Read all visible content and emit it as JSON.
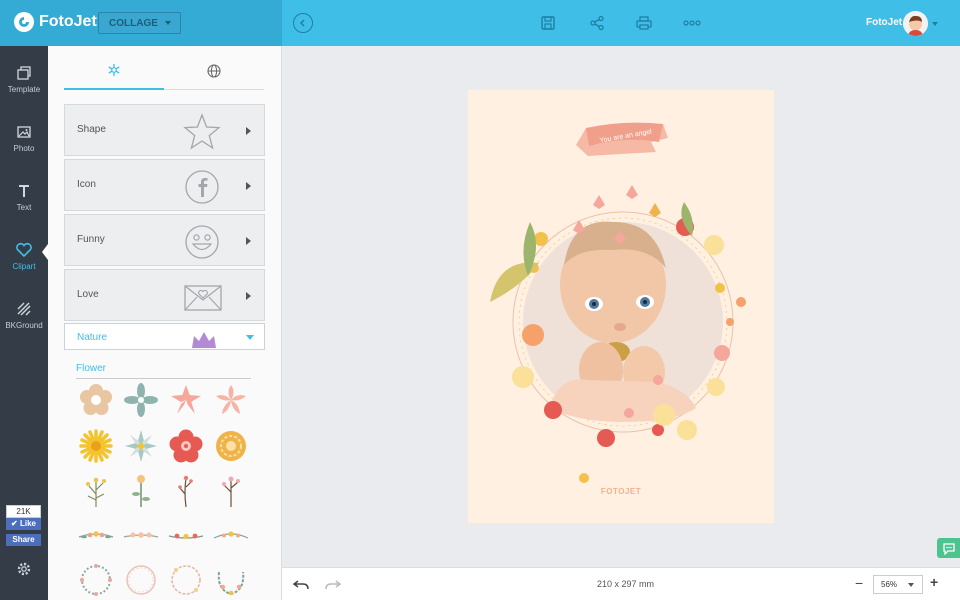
{
  "brand": {
    "name": "FotoJet",
    "color": "#3fbfe8"
  },
  "header": {
    "mode": "COLLAGE",
    "icons": [
      "back-icon",
      "save-icon",
      "share-icon",
      "print-icon",
      "more-icon"
    ],
    "user_name": "FotoJet"
  },
  "nav": {
    "items": [
      {
        "label": "Template",
        "icon": "template-icon"
      },
      {
        "label": "Photo",
        "icon": "photo-icon"
      },
      {
        "label": "Text",
        "icon": "text-icon"
      },
      {
        "label": "Clipart",
        "icon": "heart-icon",
        "active": true
      },
      {
        "label": "BKGround",
        "icon": "background-icon"
      }
    ],
    "like_count": "21K",
    "like_label": "Like",
    "share_label": "Share"
  },
  "panel": {
    "tabs": [
      "snowflake-icon",
      "globe-icon"
    ],
    "categories": [
      {
        "label": "Shape",
        "icon": "star-icon"
      },
      {
        "label": "Icon",
        "icon": "facebook-icon"
      },
      {
        "label": "Funny",
        "icon": "smiley-icon"
      },
      {
        "label": "Love",
        "icon": "envelope-heart-icon"
      }
    ],
    "selected_category": "Nature",
    "section_title": "Flower"
  },
  "canvas": {
    "background": "#fff0e2",
    "banner_text": "You are an angel",
    "footer_mark": "FOTOJET"
  },
  "footer": {
    "page_size": "210 x 297 mm",
    "zoom": "56%"
  }
}
